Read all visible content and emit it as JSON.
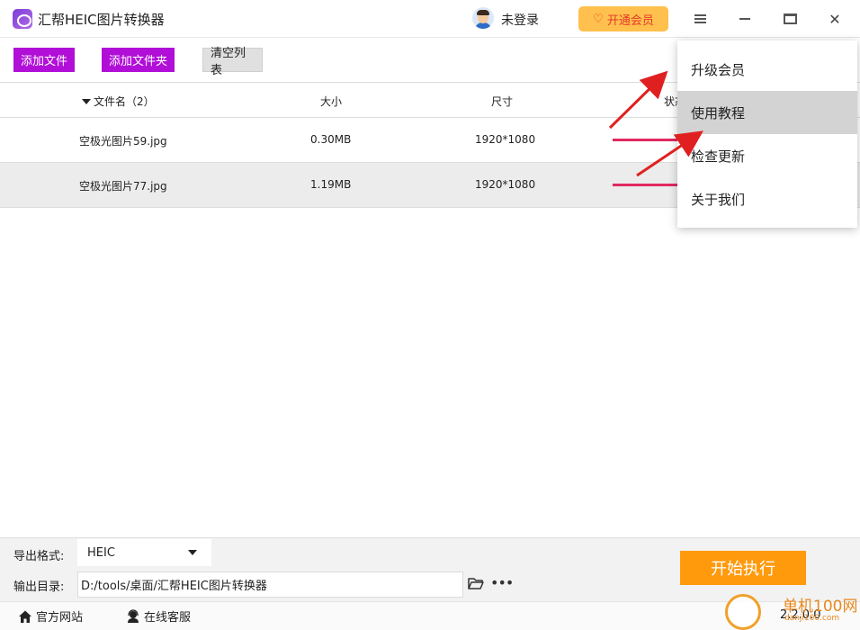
{
  "app": {
    "title": "汇帮HEIC图片转换器",
    "login_text": "未登录",
    "vip_label": "开通会员"
  },
  "toolbar": {
    "add_file": "添加文件",
    "add_folder": "添加文件夹",
    "clear_list": "清空列表"
  },
  "table": {
    "headers": {
      "name": "文件名（2）",
      "size": "大小",
      "dimensions": "尺寸",
      "status": "状态"
    },
    "rows": [
      {
        "name": "空极光图片59.jpg",
        "size": "0.30MB",
        "dimensions": "1920*1080"
      },
      {
        "name": "空极光图片77.jpg",
        "size": "1.19MB",
        "dimensions": "1920*1080"
      }
    ]
  },
  "menu": {
    "items": [
      "升级会员",
      "使用教程",
      "检查更新",
      "关于我们"
    ],
    "highlighted": "使用教程"
  },
  "settings": {
    "format_label": "导出格式:",
    "format_value": "HEIC",
    "output_label": "输出目录:",
    "output_path": "D:/tools/桌面/汇帮HEIC图片转换器"
  },
  "start_button": "开始执行",
  "footer": {
    "official_site": "官方网站",
    "online_service": "在线客服",
    "version": "2.2.0.0"
  },
  "watermark": {
    "text": "单机100网",
    "sub": "danji100.com"
  },
  "colors": {
    "accent_purple": "#b10fd8",
    "start_orange": "#ff9a0d",
    "vip_yellow": "#ffc04d",
    "progress_red": "#e0295f",
    "arrow_red": "#e02020"
  }
}
